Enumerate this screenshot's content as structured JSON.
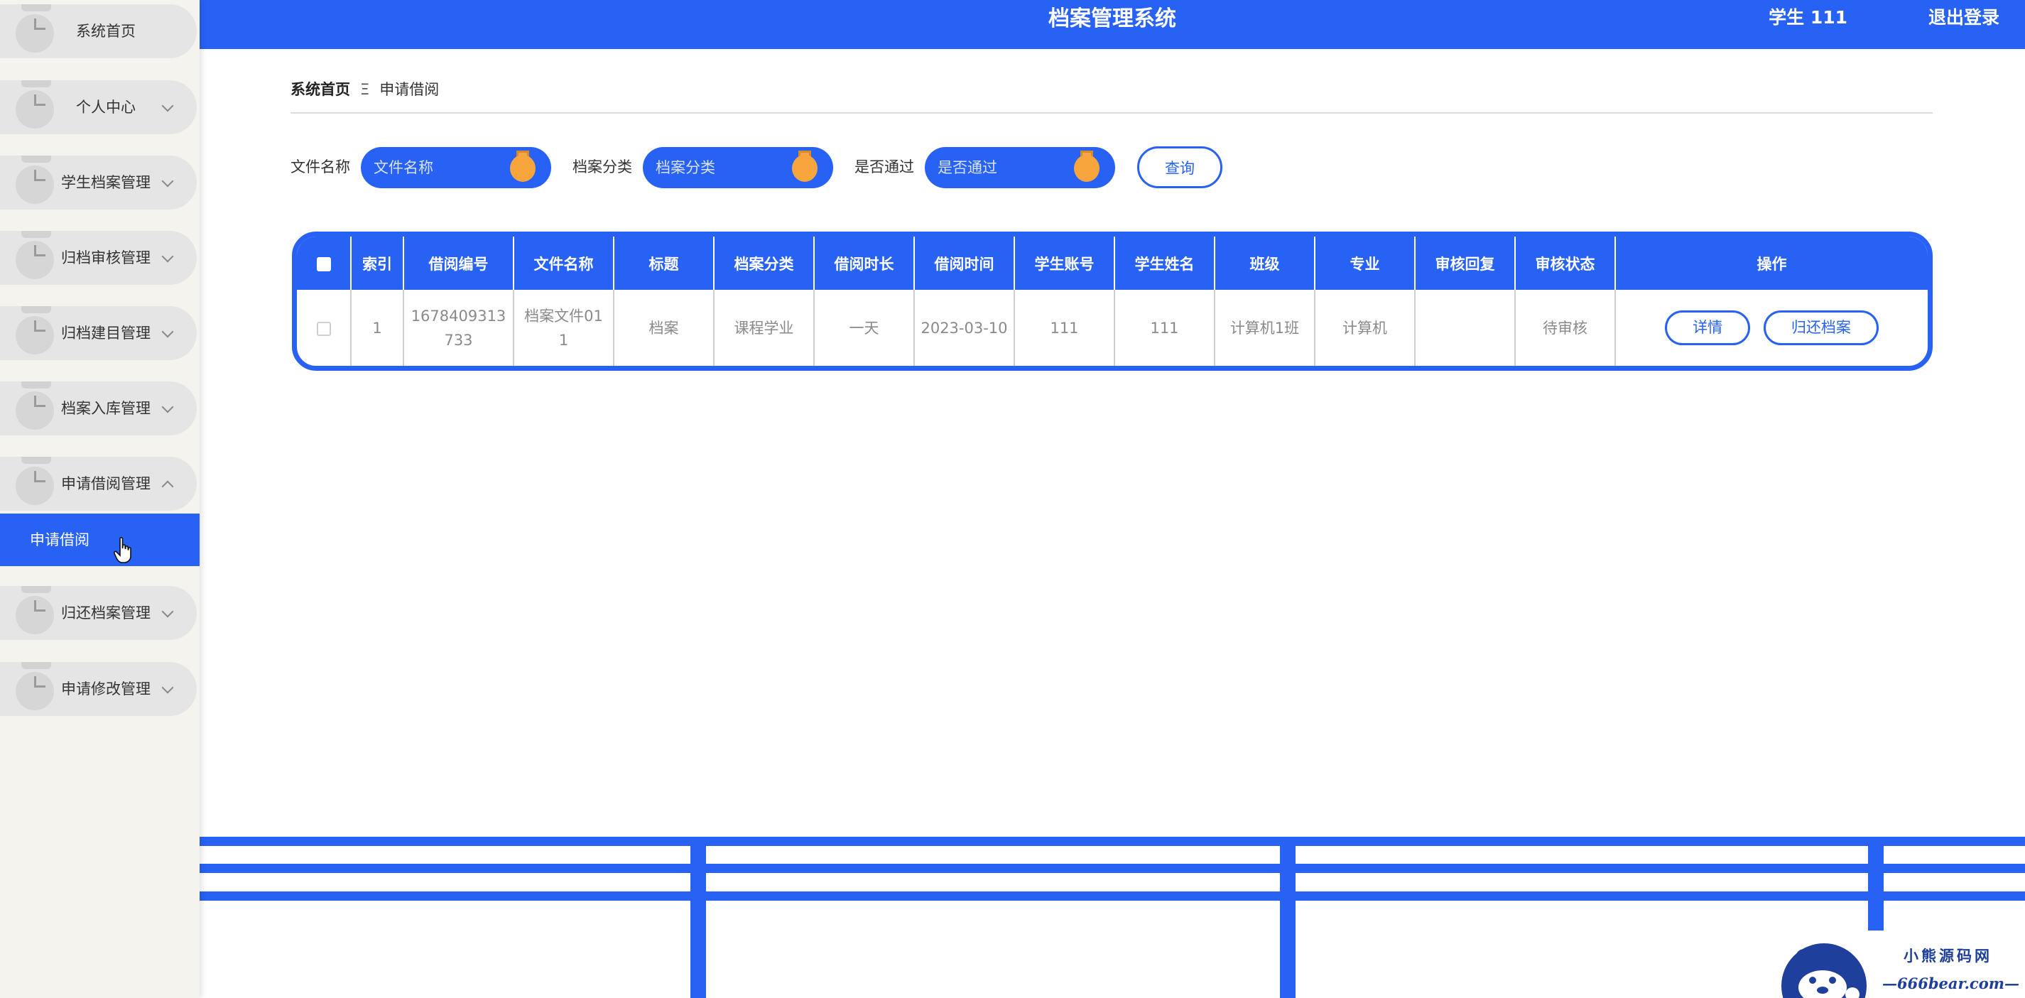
{
  "header": {
    "title": "档案管理系统",
    "user": "学生 111",
    "logout": "退出登录"
  },
  "sidebar": {
    "items": [
      {
        "label": "系统首页",
        "expandable": false
      },
      {
        "label": "个人中心",
        "expandable": true
      },
      {
        "label": "学生档案管理",
        "expandable": true
      },
      {
        "label": "归档审核管理",
        "expandable": true
      },
      {
        "label": "归档建目管理",
        "expandable": true
      },
      {
        "label": "档案入库管理",
        "expandable": true
      },
      {
        "label": "申请借阅管理",
        "expandable": true,
        "expanded": true
      },
      {
        "label": "归还档案管理",
        "expandable": true
      },
      {
        "label": "申请修改管理",
        "expandable": true
      }
    ],
    "active_subitem": "申请借阅"
  },
  "breadcrumb": {
    "home": "系统首页",
    "separator": "Ξ",
    "current": "申请借阅"
  },
  "search": {
    "fields": [
      {
        "label": "文件名称",
        "placeholder": "文件名称"
      },
      {
        "label": "档案分类",
        "placeholder": "档案分类"
      },
      {
        "label": "是否通过",
        "placeholder": "是否通过"
      }
    ],
    "button": "查询"
  },
  "table": {
    "columns": [
      "索引",
      "借阅编号",
      "文件名称",
      "标题",
      "档案分类",
      "借阅时长",
      "借阅时间",
      "学生账号",
      "学生姓名",
      "班级",
      "专业",
      "审核回复",
      "审核状态",
      "操作"
    ],
    "rows": [
      {
        "index": "1",
        "borrow_no": "1678409313733",
        "file_name": "档案文件011",
        "title": "档案",
        "category": "课程学业",
        "duration": "一天",
        "borrow_time": "2023-03-10",
        "student_account": "111",
        "student_name": "111",
        "class": "计算机1班",
        "major": "计算机",
        "reply": "",
        "status": "待审核",
        "actions": [
          "详情",
          "归还档案"
        ]
      }
    ]
  },
  "watermark": {
    "title": "小熊源码网",
    "subtitle": "—666bear.com—"
  },
  "colors": {
    "primary": "#2762f5",
    "knob": "#f7a53c",
    "sidebar_bg": "#f4f3ee",
    "menu_item_bg": "#e5e5e5"
  }
}
